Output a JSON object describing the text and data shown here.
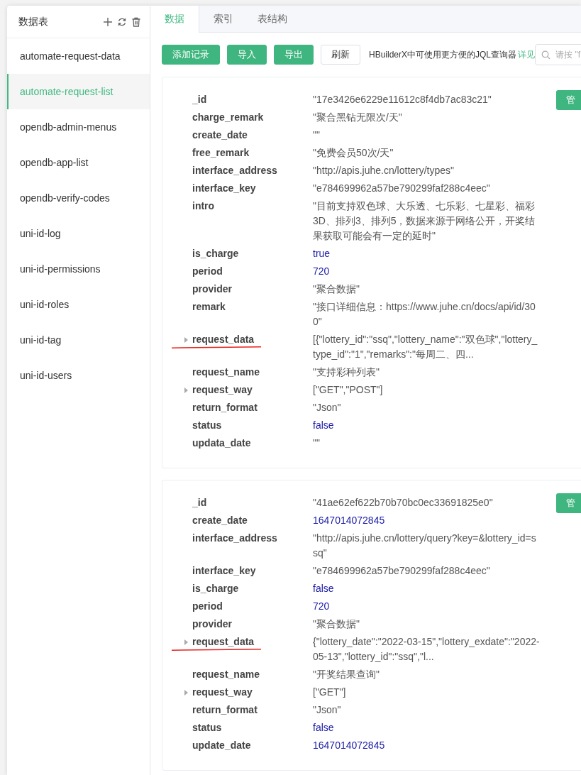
{
  "sidebar": {
    "title": "数据表",
    "items": [
      {
        "label": "automate-request-data",
        "selected": false
      },
      {
        "label": "automate-request-list",
        "selected": true
      },
      {
        "label": "opendb-admin-menus",
        "selected": false
      },
      {
        "label": "opendb-app-list",
        "selected": false
      },
      {
        "label": "opendb-verify-codes",
        "selected": false
      },
      {
        "label": "uni-id-log",
        "selected": false
      },
      {
        "label": "uni-id-permissions",
        "selected": false
      },
      {
        "label": "uni-id-roles",
        "selected": false
      },
      {
        "label": "uni-id-tag",
        "selected": false
      },
      {
        "label": "uni-id-users",
        "selected": false
      }
    ]
  },
  "tabs": [
    {
      "label": "数据",
      "selected": true
    },
    {
      "label": "索引",
      "selected": false
    },
    {
      "label": "表结构",
      "selected": false
    }
  ],
  "toolbar": {
    "buttons": [
      {
        "label": "添加记录",
        "kind": "primary"
      },
      {
        "label": "导入",
        "kind": "primary"
      },
      {
        "label": "导出",
        "kind": "primary"
      },
      {
        "label": "刷新",
        "kind": "plain"
      }
    ],
    "hint": "HBuilderX中可使用更方便的JQL查询器",
    "link": "详见",
    "search": {
      "placeholder": "请按 \"f"
    }
  },
  "records": [
    {
      "action": "管",
      "fields": [
        {
          "key": "_id",
          "value": "\"17e3426e6229e11612c8f4db7ac83c21\"",
          "kind": "string",
          "expandable": false,
          "underlined": false
        },
        {
          "key": "charge_remark",
          "value": "\"聚合黑钻无限次/天\"",
          "kind": "string",
          "expandable": false,
          "underlined": false
        },
        {
          "key": "create_date",
          "value": "\"\"",
          "kind": "string",
          "expandable": false,
          "underlined": false
        },
        {
          "key": "free_remark",
          "value": "\"免费会员50次/天\"",
          "kind": "string",
          "expandable": false,
          "underlined": false
        },
        {
          "key": "interface_address",
          "value": "\"http://apis.juhe.cn/lottery/types\"",
          "kind": "string",
          "expandable": false,
          "underlined": false
        },
        {
          "key": "interface_key",
          "value": "\"e784699962a57be790299faf288c4eec\"",
          "kind": "string",
          "expandable": false,
          "underlined": false
        },
        {
          "key": "intro",
          "value": "\"目前支持双色球、大乐透、七乐彩、七星彩、福彩3D、排列3、排列5，数据来源于网络公开，开奖结果获取可能会有一定的延时\"",
          "kind": "string",
          "expandable": false,
          "underlined": false
        },
        {
          "key": "is_charge",
          "value": "true",
          "kind": "literal",
          "expandable": false,
          "underlined": false
        },
        {
          "key": "period",
          "value": "720",
          "kind": "literal",
          "expandable": false,
          "underlined": false
        },
        {
          "key": "provider",
          "value": "\"聚合数据\"",
          "kind": "string",
          "expandable": false,
          "underlined": false
        },
        {
          "key": "remark",
          "value": "\"接口详细信息：https://www.juhe.cn/docs/api/id/300\"",
          "kind": "string",
          "expandable": false,
          "underlined": false
        },
        {
          "key": "request_data",
          "value": "[{\"lottery_id\":\"ssq\",\"lottery_name\":\"双色球\",\"lottery_type_id\":\"1\",\"remarks\":\"每周二、四...",
          "kind": "string",
          "expandable": true,
          "underlined": true
        },
        {
          "key": "request_name",
          "value": "\"支持彩种列表\"",
          "kind": "string",
          "expandable": false,
          "underlined": false
        },
        {
          "key": "request_way",
          "value": "[\"GET\",\"POST\"]",
          "kind": "string",
          "expandable": true,
          "underlined": false
        },
        {
          "key": "return_format",
          "value": "\"Json\"",
          "kind": "string",
          "expandable": false,
          "underlined": false
        },
        {
          "key": "status",
          "value": "false",
          "kind": "literal",
          "expandable": false,
          "underlined": false
        },
        {
          "key": "updata_date",
          "value": "\"\"",
          "kind": "string",
          "expandable": false,
          "underlined": false
        }
      ]
    },
    {
      "action": "管",
      "fields": [
        {
          "key": "_id",
          "value": "\"41ae62ef622b70b70bc0ec33691825e0\"",
          "kind": "string",
          "expandable": false,
          "underlined": false
        },
        {
          "key": "create_date",
          "value": "1647014072845",
          "kind": "literal",
          "expandable": false,
          "underlined": false
        },
        {
          "key": "interface_address",
          "value": "\"http://apis.juhe.cn/lottery/query?key=&lottery_id=ssq\"",
          "kind": "string",
          "expandable": false,
          "underlined": false
        },
        {
          "key": "interface_key",
          "value": "\"e784699962a57be790299faf288c4eec\"",
          "kind": "string",
          "expandable": false,
          "underlined": false
        },
        {
          "key": "is_charge",
          "value": "false",
          "kind": "literal",
          "expandable": false,
          "underlined": false
        },
        {
          "key": "period",
          "value": "720",
          "kind": "literal",
          "expandable": false,
          "underlined": false
        },
        {
          "key": "provider",
          "value": "\"聚合数据\"",
          "kind": "string",
          "expandable": false,
          "underlined": false
        },
        {
          "key": "request_data",
          "value": "{\"lottery_date\":\"2022-03-15\",\"lottery_exdate\":\"2022-05-13\",\"lottery_id\":\"ssq\",\"l...",
          "kind": "string",
          "expandable": true,
          "underlined": true
        },
        {
          "key": "request_name",
          "value": "\"开奖结果查询\"",
          "kind": "string",
          "expandable": false,
          "underlined": false
        },
        {
          "key": "request_way",
          "value": "[\"GET\"]",
          "kind": "string",
          "expandable": true,
          "underlined": false
        },
        {
          "key": "return_format",
          "value": "\"Json\"",
          "kind": "string",
          "expandable": false,
          "underlined": false
        },
        {
          "key": "status",
          "value": "false",
          "kind": "literal",
          "expandable": false,
          "underlined": false
        },
        {
          "key": "update_date",
          "value": "1647014072845",
          "kind": "literal",
          "expandable": false,
          "underlined": false
        }
      ]
    }
  ]
}
